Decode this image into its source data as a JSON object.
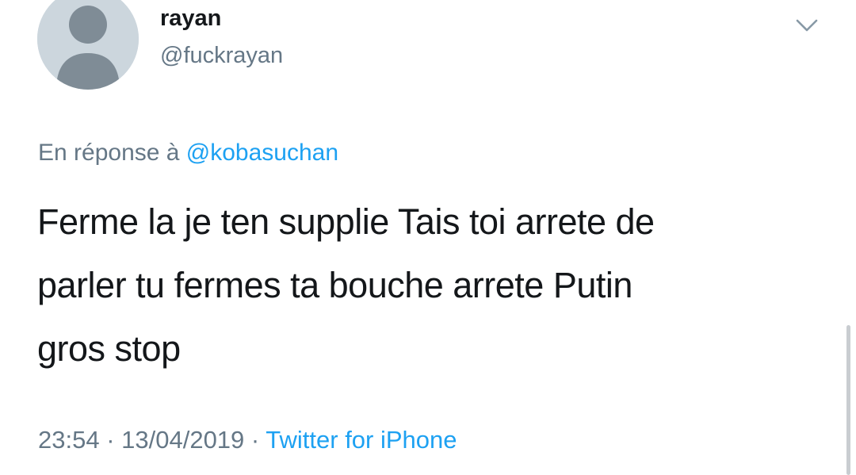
{
  "author": {
    "display_name": "rayan",
    "handle": "@fuckrayan",
    "avatar_icon": "default-profile-icon"
  },
  "menu": {
    "caret_icon": "chevron-down-icon"
  },
  "reply": {
    "prefix": "En réponse à ",
    "mention": "@kobasuchan"
  },
  "tweet": {
    "line1": "Ferme la je ten supplie Tais toi arrete de",
    "line2": "parler tu fermes ta bouche arrete Putin",
    "line3": "gros stop"
  },
  "meta": {
    "time": "23:54",
    "separator1": " · ",
    "date": "13/04/2019",
    "separator2": " · ",
    "source": "Twitter for iPhone"
  },
  "colors": {
    "text_primary": "#14171a",
    "text_secondary": "#657786",
    "link": "#1da1f2",
    "avatar_bg": "#ccd6dd",
    "avatar_figure": "#8899a6"
  }
}
